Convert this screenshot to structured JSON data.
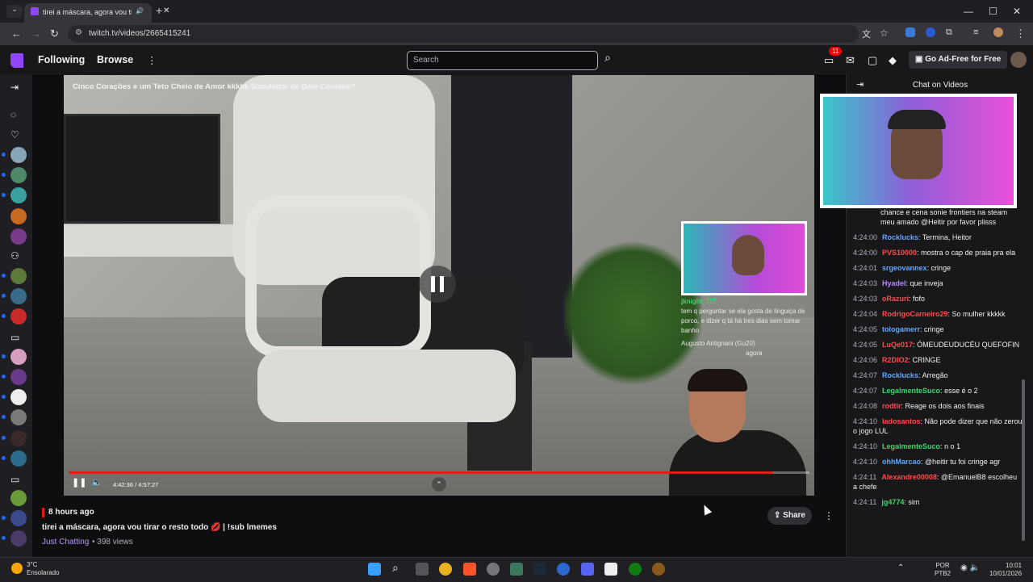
{
  "browser": {
    "tab_title": "tirei a máscara, agora vou tirar o resto todo",
    "new_tab": "+",
    "url": "twitch.tv/videos/2665415241"
  },
  "nav": {
    "following": "Following",
    "browse": "Browse",
    "search_placeholder": "Search",
    "notif_count": "11",
    "ad_free": "Go Ad-Free for Free"
  },
  "player": {
    "overlay_title": "Cinco Corações e um Teto Cheio de Amor kkkkk Simulador de Date Coreano?",
    "time": "4:42:36 / 4:57:27",
    "progress_fraction": 0.95,
    "overlay_chat": {
      "user": "jknight_777",
      "text": "tem q perguntar se ela gosta de linguiça de porco, e dizer q tá há tres dias sem tomar banho",
      "line2": "Augusto Antignani (Gu20)",
      "line3": "agora"
    }
  },
  "video_info": {
    "posted": "8 hours ago",
    "title": "tirei a máscara, agora vou tirar o resto todo 💋 | !sub lmemes",
    "category": "Just Chatting",
    "views": "• 398 views",
    "share": "Share"
  },
  "chat": {
    "header": "Chat on Videos",
    "partial": "chance e cena sonie frontiers na steam meu amado @Heitir por favor plisss",
    "messages": [
      {
        "time": "4:24:00",
        "user": "Rocklucks",
        "color": "#5fa8ff",
        "text": ": Termina, Heitor"
      },
      {
        "time": "4:24:00",
        "user": "PVS10000",
        "color": "#ff4a4a",
        "text": ": mostra o cap de praia pra ela"
      },
      {
        "time": "4:24:01",
        "user": "srgeovannex",
        "color": "#5fa8ff",
        "text": ": cringe"
      },
      {
        "time": "4:24:03",
        "user": "Hyadel",
        "color": "#b887ff",
        "text": ": que inveja"
      },
      {
        "time": "4:24:03",
        "user": "oRazuri",
        "color": "#ff4a4a",
        "text": ": fofo"
      },
      {
        "time": "4:24:04",
        "user": "RodrigoCarneiro29",
        "color": "#ff4a4a",
        "text": ": So mulher kkkkk"
      },
      {
        "time": "4:24:05",
        "user": "tologamerr",
        "color": "#5fa8ff",
        "text": ": cringe"
      },
      {
        "time": "4:24:05",
        "user": "LuQe017",
        "color": "#ff4a4a",
        "text": ": ÓMEUDEUDUCÉU QUEFOFIN"
      },
      {
        "time": "4:24:06",
        "user": "R2DIO2",
        "color": "#ff4a4a",
        "text": ": CRINGE"
      },
      {
        "time": "4:24:07",
        "user": "Rocklucks",
        "color": "#5fa8ff",
        "text": ": Arregão"
      },
      {
        "time": "4:24:07",
        "user": "LegalmenteSuco",
        "color": "#3cd66a",
        "text": ": esse é o 2"
      },
      {
        "time": "4:24:08",
        "user": "rodtir",
        "color": "#ff4a4a",
        "text": ": Reage os dois aos finais"
      },
      {
        "time": "4:24:10",
        "user": "ladosantos",
        "color": "#ff4a4a",
        "text": ": Não pode dizer que não zerou o jogo LUL"
      },
      {
        "time": "4:24:10",
        "user": "LegalmenteSuco",
        "color": "#3cd66a",
        "text": ": n o 1"
      },
      {
        "time": "4:24:10",
        "user": "ohhMarcao",
        "color": "#5fa8ff",
        "text": ": @heitir tu foi cringe agr"
      },
      {
        "time": "4:24:11",
        "user": "Alexandre00008",
        "color": "#ff4a4a",
        "text": ": @EmanuelB8 escolheu a chefe"
      },
      {
        "time": "4:24:11",
        "user": "jg4774",
        "color": "#3cd66a",
        "text": ": sim"
      }
    ]
  },
  "taskbar": {
    "temp": "3°C",
    "weather": "Ensolarado",
    "lang": "POR",
    "layout": "PTB2",
    "time": "10:01",
    "date": "10/01/2026"
  }
}
